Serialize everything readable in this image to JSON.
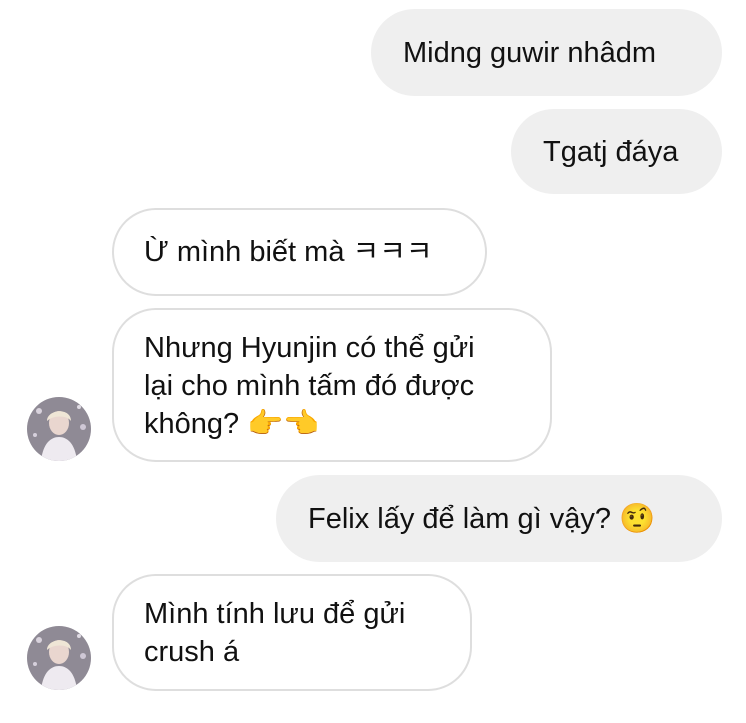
{
  "conversation": {
    "messages": [
      {
        "from": "me",
        "lines": [
          "Midng guwir nhâdm"
        ]
      },
      {
        "from": "me",
        "lines": [
          "Tgatj đáya"
        ]
      },
      {
        "from": "them",
        "lines": [
          "Ừ mình biết mà ㅋㅋㅋ"
        ]
      },
      {
        "from": "them",
        "lines": [
          "Nhưng Hyunjin có thể gửi",
          "lại cho mình tấm đó được",
          "không? 👉👈"
        ]
      },
      {
        "from": "me",
        "lines": [
          "Felix lấy để làm gì vậy? 🤨"
        ]
      },
      {
        "from": "them",
        "lines": [
          "Mình tính lưu để gửi",
          "crush á"
        ]
      }
    ],
    "avatar_icon": "user-avatar-photo"
  },
  "colors": {
    "sent_bubble": "#efefef",
    "received_border": "#dedede",
    "text": "#111111"
  }
}
